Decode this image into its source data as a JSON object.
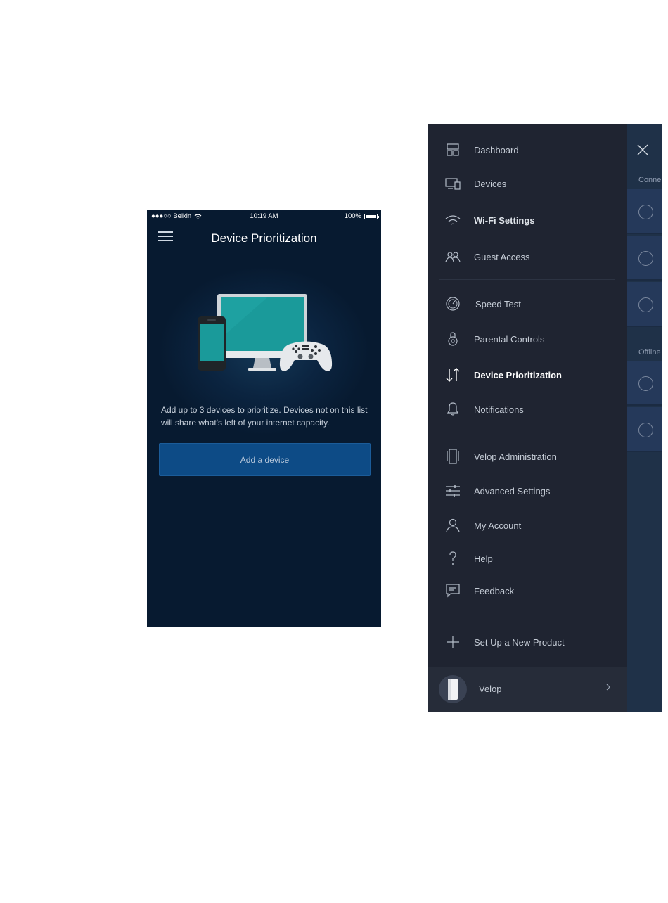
{
  "phone": {
    "status": {
      "carrier": "●●●○○ Belkin",
      "time": "10:19 AM",
      "battery": "100%"
    },
    "title": "Device Prioritization",
    "description": "Add up to 3 devices to prioritize. Devices not on this list will share what's left of your internet capacity.",
    "add_button": "Add a device",
    "colors": {
      "background": "#0b2440",
      "button": "#0d4b86"
    }
  },
  "menu": {
    "items": [
      {
        "label": "Dashboard",
        "icon": "dashboard-icon"
      },
      {
        "label": "Devices",
        "icon": "devices-icon"
      },
      {
        "label": "Wi-Fi Settings",
        "icon": "wifi-icon"
      },
      {
        "label": "Guest Access",
        "icon": "guest-icon"
      },
      {
        "label": "Speed Test",
        "icon": "speedometer-icon"
      },
      {
        "label": "Parental Controls",
        "icon": "lock-icon"
      },
      {
        "label": "Device Prioritization",
        "icon": "priority-arrows-icon",
        "active": true
      },
      {
        "label": "Notifications",
        "icon": "bell-icon"
      },
      {
        "label": "Velop Administration",
        "icon": "node-icon"
      },
      {
        "label": "Advanced Settings",
        "icon": "sliders-icon"
      },
      {
        "label": "My Account",
        "icon": "user-icon"
      },
      {
        "label": "Help",
        "icon": "question-icon"
      },
      {
        "label": "Feedback",
        "icon": "chat-icon"
      },
      {
        "label": "Set Up a New Product",
        "icon": "plus-icon"
      }
    ],
    "footer": {
      "label": "Velop",
      "icon": "velop-node-icon"
    },
    "behind": {
      "connected_header": "Conne",
      "offline_header": "Offline"
    },
    "colors": {
      "drawer": "#1f2431",
      "behind": "#1f3148"
    }
  }
}
